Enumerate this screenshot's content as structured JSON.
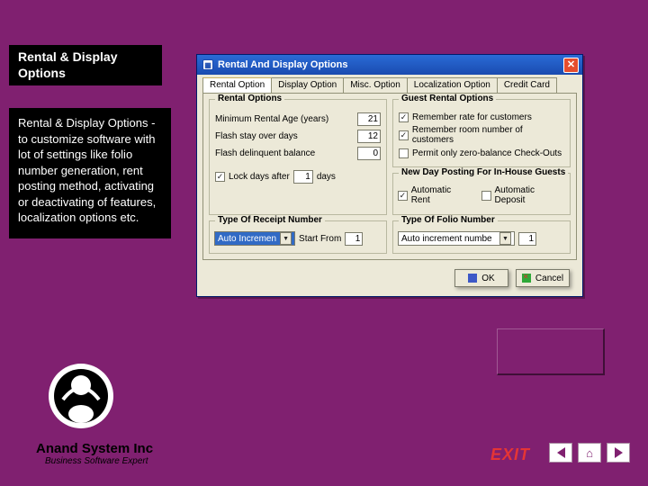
{
  "sidebar": {
    "title": "Rental & Display Options",
    "description": "Rental & Display Options - to customize software with lot of settings like folio number generation, rent posting method, activating or deactivating of features, localization options etc."
  },
  "company": {
    "name": "Anand System Inc",
    "tagline": "Business Software Expert"
  },
  "exit": "EXIT",
  "dialog": {
    "title": "Rental And Display Options",
    "tabs": [
      "Rental Option",
      "Display Option",
      "Misc. Option",
      "Localization Option",
      "Credit Card"
    ],
    "rental_options": {
      "legend": "Rental Options",
      "min_age_label": "Minimum Rental Age (years)",
      "min_age_value": "21",
      "flash_stay_label": "Flash stay over days",
      "flash_stay_value": "12",
      "flash_delinq_label": "Flash delinquent balance",
      "flash_delinq_value": "0",
      "lock_days_label": "Lock days after",
      "lock_days_value": "1",
      "lock_days_suffix": "days"
    },
    "guest_options": {
      "legend": "Guest Rental Options",
      "remember_rate": "Remember rate for customers",
      "remember_room": "Remember room number of customers",
      "permit_zero": "Permit only zero-balance Check-Outs"
    },
    "new_day": {
      "legend": "New Day Posting For In-House Guests",
      "auto_rent": "Automatic Rent",
      "auto_deposit": "Automatic Deposit"
    },
    "receipt": {
      "legend": "Type Of Receipt Number",
      "mode": "Auto Incremen",
      "start_from_label": "Start From",
      "start_from_value": "1"
    },
    "folio": {
      "legend": "Type Of Folio Number",
      "mode": "Auto increment numbe",
      "start_from_value": "1"
    },
    "buttons": {
      "ok": "OK",
      "cancel": "Cancel"
    }
  }
}
